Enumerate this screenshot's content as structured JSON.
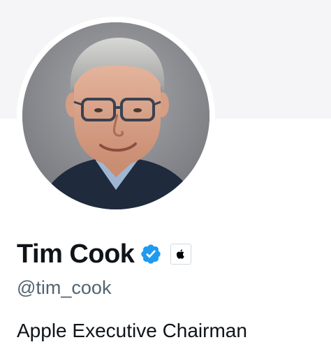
{
  "profile": {
    "display_name": "Tim Cook",
    "handle": "@tim_cook",
    "bio": "Apple Executive Chairman",
    "verified_color": "#1d9bf0",
    "affiliate_icon": "apple-logo-icon"
  },
  "colors": {
    "banner": "#f5f5f7",
    "name_text": "#0f1419",
    "handle_text": "#536471"
  }
}
